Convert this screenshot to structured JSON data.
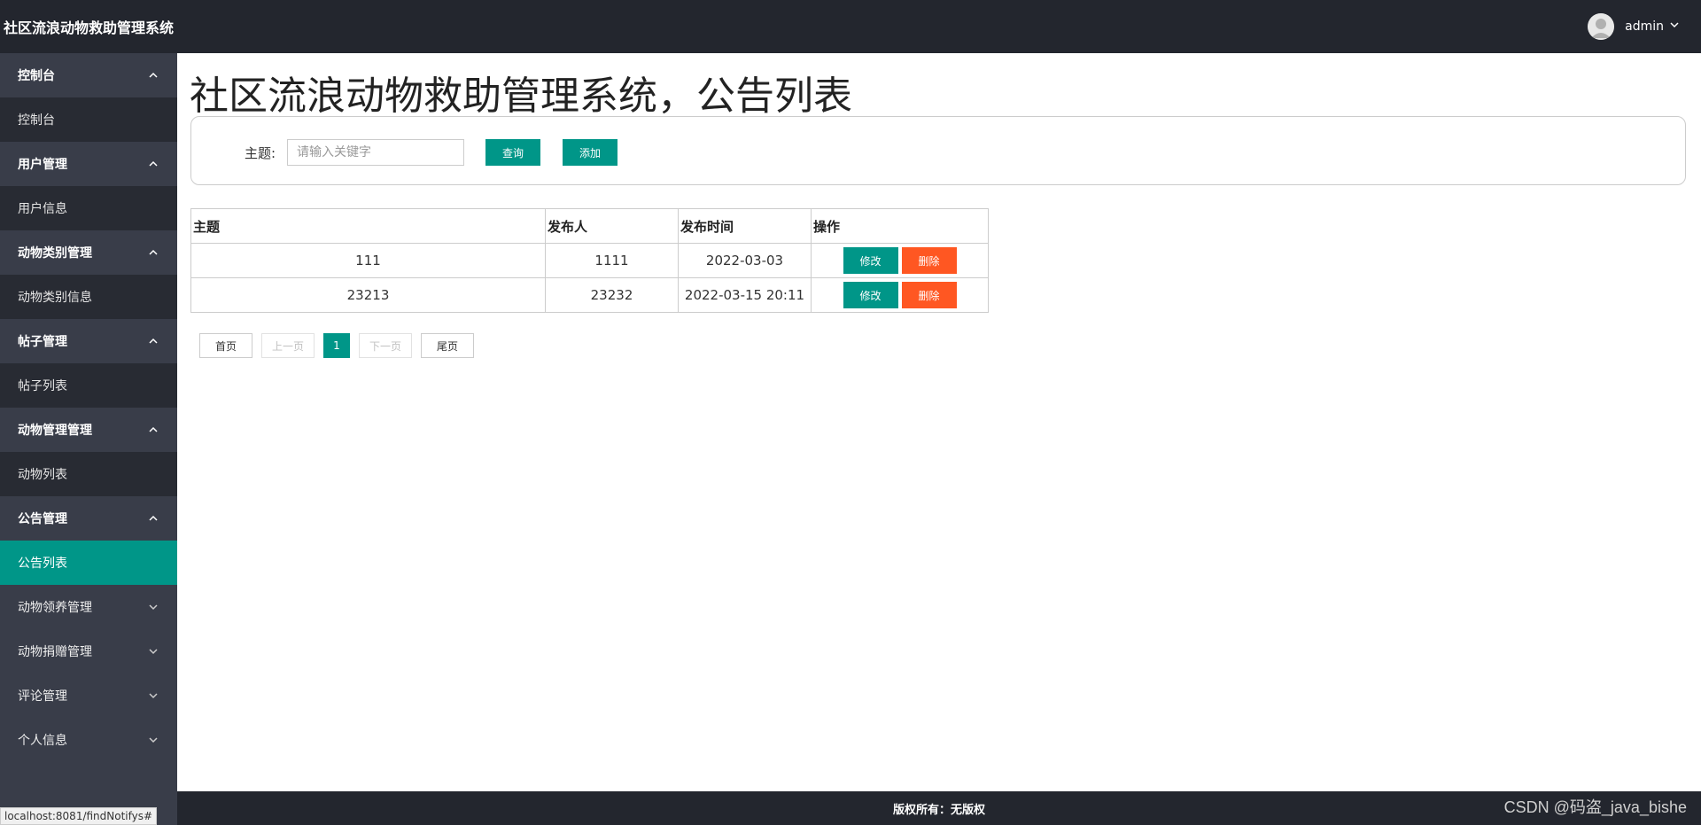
{
  "app": {
    "title": "社区流浪动物救助管理系统"
  },
  "header": {
    "username": "admin"
  },
  "sidebar": {
    "groups": [
      {
        "label": "控制台",
        "expanded": true,
        "children": [
          "控制台"
        ]
      },
      {
        "label": "用户管理",
        "expanded": true,
        "children": [
          "用户信息"
        ]
      },
      {
        "label": "动物类别管理",
        "expanded": true,
        "children": [
          "动物类别信息"
        ]
      },
      {
        "label": "帖子管理",
        "expanded": true,
        "children": [
          "帖子列表"
        ]
      },
      {
        "label": "动物管理管理",
        "expanded": true,
        "children": [
          "动物列表"
        ]
      },
      {
        "label": "公告管理",
        "expanded": true,
        "children": [
          "公告列表"
        ]
      },
      {
        "label": "动物领养管理",
        "expanded": false,
        "children": []
      },
      {
        "label": "动物捐赠管理",
        "expanded": false,
        "children": []
      },
      {
        "label": "评论管理",
        "expanded": false,
        "children": []
      },
      {
        "label": "个人信息",
        "expanded": false,
        "children": []
      }
    ],
    "active_item": "公告列表"
  },
  "main": {
    "page_title": "社区流浪动物救助管理系统，公告列表",
    "search": {
      "label": "主题:",
      "placeholder": "请输入关键字",
      "value": "",
      "search_button": "查询",
      "add_button": "添加"
    },
    "table": {
      "headers": [
        "主题",
        "发布人",
        "发布时间",
        "操作"
      ],
      "rows": [
        {
          "subject": "111",
          "publisher": "1111",
          "time": "2022-03-03",
          "edit": "修改",
          "delete": "删除"
        },
        {
          "subject": "23213",
          "publisher": "23232",
          "time": "2022-03-15 20:11",
          "edit": "修改",
          "delete": "删除"
        }
      ]
    },
    "pagination": {
      "first": "首页",
      "prev": "上一页",
      "current": "1",
      "next": "下一页",
      "last": "尾页"
    }
  },
  "footer": {
    "copyright": "版权所有：无版权"
  },
  "status_bar": {
    "url": "localhost:8081/findNotifys#"
  },
  "watermark": "CSDN @码盗_java_bishe",
  "colors": {
    "accent": "#009688",
    "danger": "#ff5722",
    "sidebar_bg": "#393d49",
    "header_bg": "#23262e"
  }
}
